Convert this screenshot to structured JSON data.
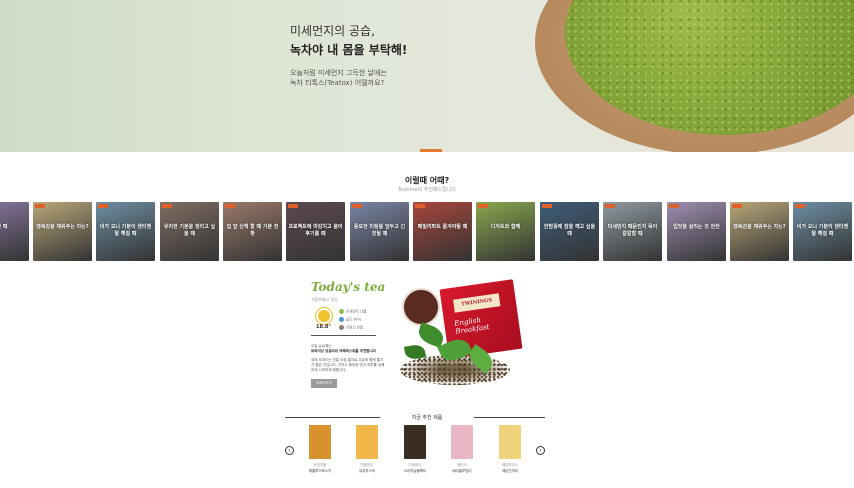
{
  "hero": {
    "line1": "미세먼지의 공습,",
    "line2": "녹차야 내 몸을 부탁해!",
    "sub1": "오늘처럼 미세먼지 그득한 날에는",
    "sub2": "녹차 티톡스(Teatox) 어떨까요?"
  },
  "section": {
    "title": "이럴때 어때?",
    "subtitle": "Teatime이 추천해드립니다"
  },
  "cards": [
    {
      "caption": "…한 때",
      "bg": "#8c7aa3"
    },
    {
      "caption": "행복감을 채워주는 차는?",
      "bg": "#b9a779"
    },
    {
      "caption": "비가 오니 기분이 센티멘탈 해질 때",
      "bg": "#6d8ea3"
    },
    {
      "caption": "유리한 기분을 정리고 싶을 때",
      "bg": "#7f6e63"
    },
    {
      "caption": "집 앞 산책 할 때 기분 전환",
      "bg": "#9a7a6a"
    },
    {
      "caption": "프로젝트에 마감지고 울어 후기를 때",
      "bg": "#5e4a52"
    },
    {
      "caption": "중요한 미팅을 앞두고 긴장될 때",
      "bg": "#7b86a6"
    },
    {
      "caption": "패밀리파트 즐겨야될 때",
      "bg": "#a8463c"
    },
    {
      "caption": "디저트와 함께",
      "bg": "#8aa74f"
    },
    {
      "caption": "한밤중에 잠을 깨고 싶을 때",
      "bg": "#3f5d7a"
    },
    {
      "caption": "미세먼지 때문인지 목이 칼칼할 때",
      "bg": "#8e9aa1"
    },
    {
      "caption": "입맛을 살리는 것 한잔",
      "bg": "#9f8fb2"
    },
    {
      "caption": "행복감을 채워주는 차는?",
      "bg": "#b9a779"
    },
    {
      "caption": "비가 오니 기분이 센티멘탈 해질 때",
      "bg": "#6d8ea3"
    }
  ],
  "today": {
    "title": "Today's tea",
    "date": "서울특별시 맑음",
    "temp": "18.8°",
    "wx1": "미세먼지 나쁨",
    "wx2": "습도 60%",
    "wx3": "자외선 보통",
    "desc_head": "오늘 날씨에는",
    "desc_bold": "트와이닝 잉글리쉬 브렉퍼스트를 추천합니다",
    "desc_body": "세계 모여드는 전통 아침 홍차로 우유와 함께 즐기기 좋은 차입니다. 진하고 풍부한 맛이 하루를 상쾌하게 시작하게 해줍니다.",
    "button": "자세히보기"
  },
  "teabox": {
    "label": "TWININGS",
    "name1": "English",
    "name2": "Breakfast",
    "badge": "English Breakfast"
  },
  "reco": {
    "title": "지금 추천 제품",
    "prev": "‹",
    "next": "›",
    "products": [
      {
        "brand": "카라차음",
        "name": "애플루이보스차",
        "color": "#d9902f"
      },
      {
        "brand": "다원하나",
        "name": "유자차스틱",
        "color": "#f0b84a"
      },
      {
        "brand": "다원하나",
        "name": "오리지널블랙티",
        "color": "#3a2e22"
      },
      {
        "brand": "앤티크",
        "name": "베리블루밍티",
        "color": "#e9b6c4"
      },
      {
        "brand": "레몬하우스",
        "name": "레몬진저티",
        "color": "#efd37a"
      }
    ]
  }
}
